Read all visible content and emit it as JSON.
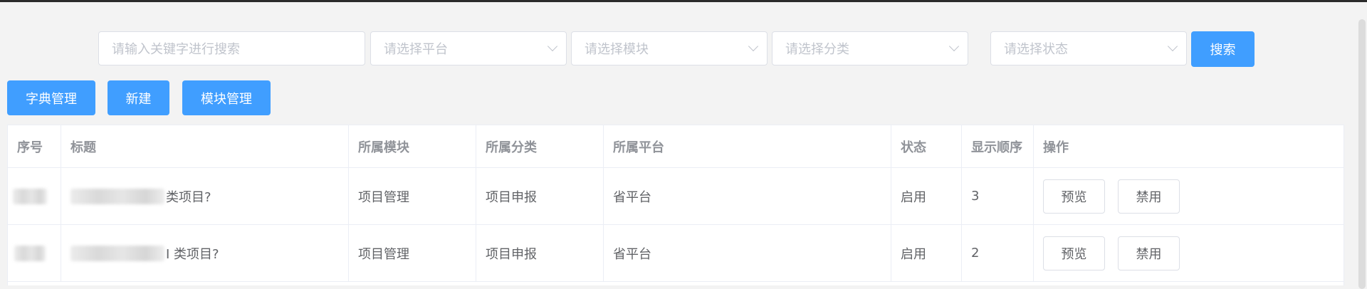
{
  "filters": {
    "keyword_placeholder": "请输入关键字进行搜索",
    "platform_placeholder": "请选择平台",
    "module_placeholder": "请选择模块",
    "category_placeholder": "请选择分类",
    "status_placeholder": "请选择状态",
    "search_label": "搜索"
  },
  "actions": {
    "dict_label": "字典管理",
    "new_label": "新建",
    "module_label": "模块管理"
  },
  "table": {
    "headers": {
      "index": "序号",
      "title": "标题",
      "module": "所属模块",
      "category": "所属分类",
      "platform": "所属平台",
      "status": "状态",
      "order": "显示顺序",
      "ops": "操作"
    },
    "rows": [
      {
        "title_suffix": "类项目?",
        "module": "项目管理",
        "category": "项目申报",
        "platform": "省平台",
        "status": "启用",
        "order": "3",
        "preview_label": "预览",
        "disable_label": "禁用"
      },
      {
        "title_suffix": "I 类项目?",
        "module": "项目管理",
        "category": "项目申报",
        "platform": "省平台",
        "status": "启用",
        "order": "2",
        "preview_label": "预览",
        "disable_label": "禁用"
      }
    ]
  },
  "colors": {
    "primary": "#409eff",
    "background": "#f3f3f3",
    "border": "#dcdfe6"
  }
}
